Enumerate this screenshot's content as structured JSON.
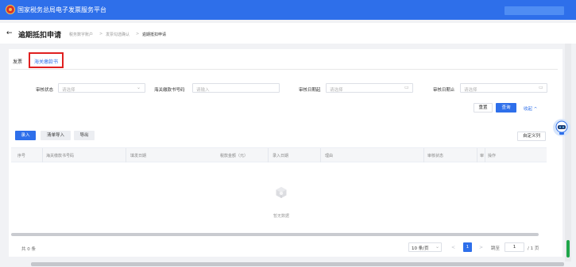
{
  "header": {
    "site_title": "国家税务总局电子发票服务平台"
  },
  "titlebar": {
    "back_icon": "←",
    "page_title": "逾期抵扣申请",
    "breadcrumb": [
      "税务数字账户",
      "发票勾选确认",
      "逾期抵扣申请"
    ],
    "breadcrumb_sep": ">"
  },
  "tabs": [
    {
      "label": "发票",
      "active": false
    },
    {
      "label": "海关缴款书",
      "active": true
    }
  ],
  "filters": [
    {
      "label": "审核状态",
      "placeholder": "请选择",
      "icon": "chevron-down-icon",
      "glyph": "⌄"
    },
    {
      "label": "海关缴款书号码",
      "placeholder": "请输入"
    },
    {
      "label": "审核日期起",
      "placeholder": "请选择",
      "icon": "calendar-icon",
      "glyph": "▭"
    },
    {
      "label": "审核日期止",
      "placeholder": "请选择",
      "icon": "calendar-icon",
      "glyph": "▭"
    }
  ],
  "actions": {
    "reset": "重置",
    "search": "查询",
    "collapse": "收起 ^"
  },
  "toolbar": {
    "add": "录入",
    "import": "清单导入",
    "export": "导出",
    "custom_columns": "自定义列"
  },
  "table": {
    "columns": [
      "序号",
      "海关缴款书号码",
      "填发日期",
      "税款金额（元）",
      "录入日期",
      "理由",
      "审核状态",
      "审",
      "操作"
    ],
    "empty_text": "暂无数据"
  },
  "pagination": {
    "total": "共 0 条",
    "page_size": "10 条/页",
    "page_size_icon": "⌄",
    "prev": "<",
    "next": ">",
    "current_page": "1",
    "jump_label": "跳至",
    "jump_value": "1",
    "page_total": "/ 1 页"
  },
  "colors": {
    "primary": "#2e6fea",
    "highlight": "#e02020",
    "topbar": "#2e6fea"
  }
}
